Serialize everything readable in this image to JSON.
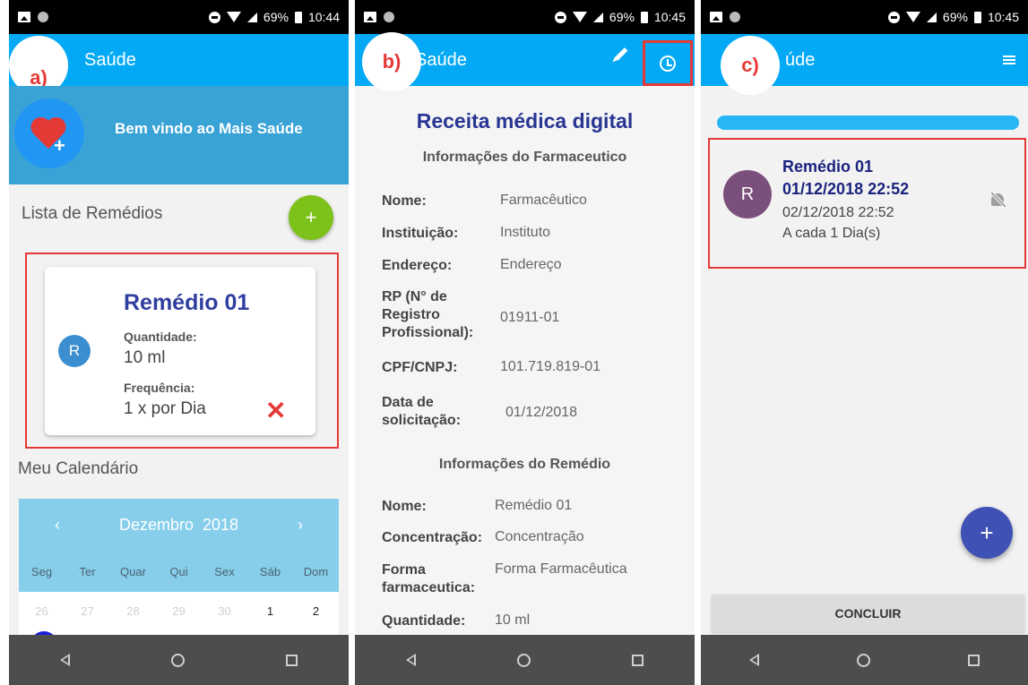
{
  "status_bar": {
    "p1": {
      "battery": "69%",
      "time": "10:44"
    },
    "p2": {
      "battery": "69%",
      "time": "10:45"
    },
    "p3": {
      "battery": "69%",
      "time": "10:45"
    }
  },
  "panel_a": {
    "label": "a)",
    "app_title": "Saúde",
    "welcome": "Bem vindo ao Mais Saúde",
    "list_title": "Lista de Remédios",
    "add_label": "+",
    "med": {
      "name": "Remédio 01",
      "avatar": "R",
      "qty_label": "Quantidade:",
      "qty_value": "10 ml",
      "freq_label": "Frequência:",
      "freq_value": "1 x por Dia",
      "delete": "✕"
    },
    "calendar_title": "Meu Calendário",
    "calendar": {
      "prev": "‹",
      "next": "›",
      "month": "Dezembro",
      "year": "2018",
      "weekdays": [
        "Seg",
        "Ter",
        "Quar",
        "Qui",
        "Sex",
        "Sáb",
        "Dom"
      ],
      "days": [
        "26",
        "27",
        "28",
        "29",
        "30",
        "1",
        "2"
      ]
    }
  },
  "panel_b": {
    "label": "b)",
    "app_title": "Saúde",
    "title": "Receita médica digital",
    "pharm_section": "Informações do Farmaceutico",
    "pharm": {
      "nome_l": "Nome:",
      "nome_v": "Farmacêutico",
      "inst_l": "Instituição:",
      "inst_v": "Instituto",
      "end_l": "Endereço:",
      "end_v": "Endereço",
      "rp_l1": "RP (N° de",
      "rp_l2": "Registro",
      "rp_l3": "Profissional):",
      "rp_v": "01911-01",
      "cpf_l": "CPF/CNPJ:",
      "cpf_v": "101.719.819-01",
      "data_l1": "Data de",
      "data_l2": "solicitação:",
      "data_v": "01/12/2018"
    },
    "med_section": "Informações do Remédio",
    "med": {
      "nome_l": "Nome:",
      "nome_v": "Remédio 01",
      "conc_l": "Concentração:",
      "conc_v": "Concentração",
      "forma_l1": "Forma",
      "forma_l2": "farmaceutica:",
      "forma_v": "Forma Farmacêutica",
      "qty_l": "Quantidade:",
      "qty_v": "10 ml"
    }
  },
  "panel_c": {
    "label": "c)",
    "app_title": "úde",
    "reminder": {
      "avatar": "R",
      "name": "Remédio 01",
      "start": "01/12/2018 22:52",
      "next": "02/12/2018 22:52",
      "interval": "A cada 1 Dia(s)"
    },
    "fab": "+",
    "conclude": "CONCLUIR"
  },
  "colors": {
    "primary": "#03a9f4",
    "highlight": "#e53935",
    "title_blue": "#283593",
    "green_fab": "#7cc21b",
    "indigo_fab": "#3f51b5"
  }
}
